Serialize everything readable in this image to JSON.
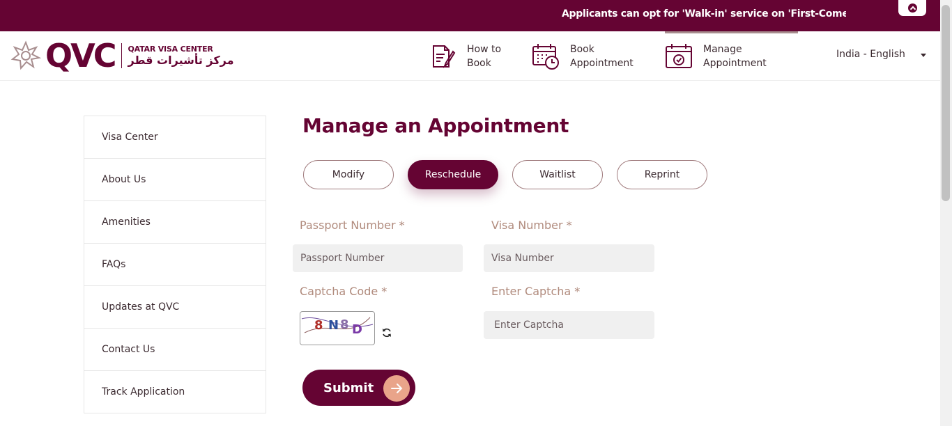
{
  "announcement": {
    "text": "Applicants can opt for 'Walk-in' service on 'First-Come-First-Served' basis"
  },
  "logo": {
    "wordmark": "QVC",
    "name_en": "QATAR VISA CENTER",
    "name_ar": "مركز تأشيرات قطر"
  },
  "nav": {
    "items": [
      {
        "line1": "How to",
        "line2": "Book"
      },
      {
        "line1": "Book",
        "line2": "Appointment"
      },
      {
        "line1": "Manage",
        "line2": "Appointment"
      }
    ],
    "language": "India - English"
  },
  "sidebar": {
    "items": [
      {
        "label": "Visa Center"
      },
      {
        "label": "About Us"
      },
      {
        "label": "Amenities"
      },
      {
        "label": "FAQs"
      },
      {
        "label": "Updates at QVC"
      },
      {
        "label": "Contact Us"
      },
      {
        "label": "Track Application"
      }
    ]
  },
  "main": {
    "title": "Manage an Appointment",
    "tabs": [
      {
        "label": "Modify"
      },
      {
        "label": "Reschedule"
      },
      {
        "label": "Waitlist"
      },
      {
        "label": "Reprint"
      }
    ],
    "active_tab": "Reschedule",
    "form": {
      "passport": {
        "label": "Passport Number *",
        "placeholder": "Passport Number",
        "value": ""
      },
      "visa": {
        "label": "Visa Number *",
        "placeholder": "Visa Number",
        "value": ""
      },
      "captcha_code": {
        "label": "Captcha Code *",
        "text": "8N8D"
      },
      "enter_captcha": {
        "label": "Enter Captcha *",
        "placeholder": "Enter Captcha",
        "value": ""
      },
      "submit_label": "Submit"
    }
  },
  "colors": {
    "brand": "#650433",
    "label": "#b08a7c",
    "accent": "#e9a48a",
    "input_bg": "#f0f0f0"
  },
  "icons": [
    "chevron-up-icon",
    "qvc-star-logo-icon",
    "how-to-book-icon",
    "calendar-clock-icon",
    "calendar-check-icon",
    "caret-down-icon",
    "refresh-icon",
    "arrow-right-icon"
  ]
}
